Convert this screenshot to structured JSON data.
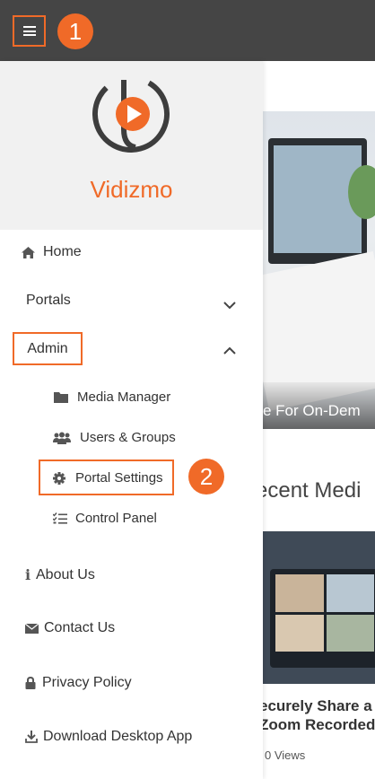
{
  "topbar": {
    "menu_icon": "hamburger-icon",
    "step_badge_1": "1"
  },
  "brand": {
    "logo_icon": "vidizmo-play-logo",
    "name": "Vidizmo"
  },
  "nav": {
    "home": {
      "label": "Home",
      "icon": "home-icon"
    },
    "portals": {
      "label": "Portals",
      "icon": "chevron-down-icon"
    },
    "admin": {
      "label": "Admin",
      "icon": "chevron-up-icon",
      "items": [
        {
          "label": "Media Manager",
          "icon": "folder-icon"
        },
        {
          "label": "Users & Groups",
          "icon": "users-icon"
        },
        {
          "label": "Portal Settings",
          "icon": "gear-icon"
        },
        {
          "label": "Control Panel",
          "icon": "checklist-icon"
        }
      ]
    },
    "about": {
      "label": "About Us",
      "icon": "info-icon"
    },
    "contact": {
      "label": "Contact Us",
      "icon": "envelope-icon"
    },
    "privacy": {
      "label": "Privacy Policy",
      "icon": "lock-icon"
    },
    "download": {
      "label": "Download Desktop App",
      "icon": "download-icon"
    }
  },
  "step_badge_2": "2",
  "content": {
    "hero_caption": "e For On-Dem",
    "recent_title": "ecent Medi",
    "video_title_line1": "ecurely Share a",
    "video_title_line2": "Zoom Recorded",
    "views": "0 Views"
  },
  "colors": {
    "accent": "#f06a28",
    "topbar": "#454545",
    "brand_bg": "#f1f1f1"
  }
}
